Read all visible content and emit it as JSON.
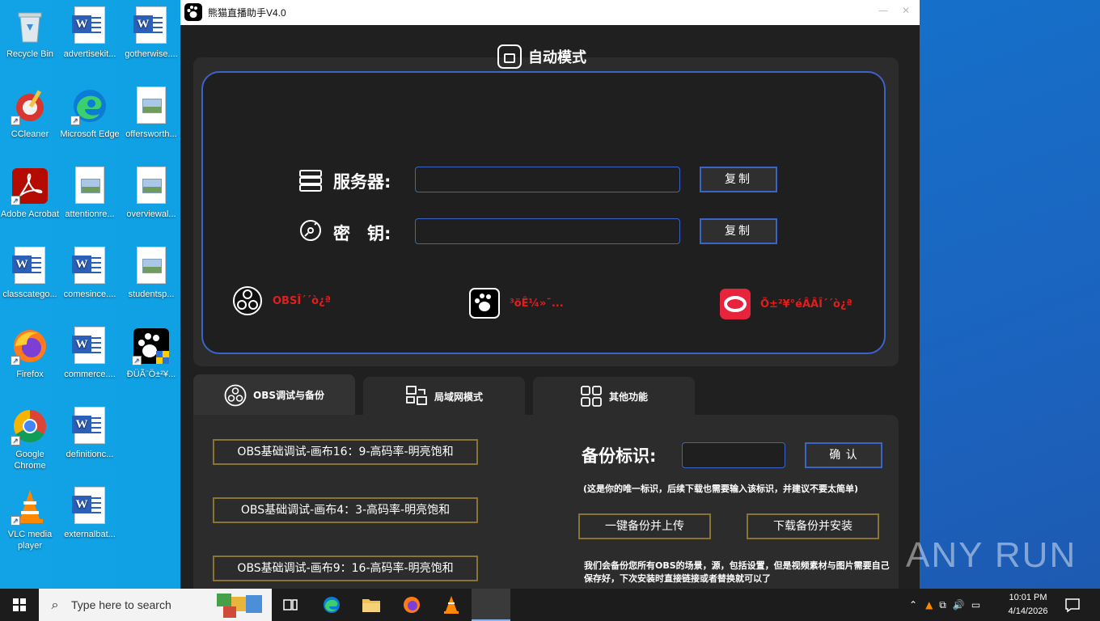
{
  "desktop": {
    "icons": [
      {
        "label": "Recycle Bin"
      },
      {
        "label": "advertisekit..."
      },
      {
        "label": "gotherwise...."
      },
      {
        "label": "CCleaner"
      },
      {
        "label": "Microsoft Edge"
      },
      {
        "label": "offersworth..."
      },
      {
        "label": "Adobe Acrobat"
      },
      {
        "label": "attentionre..."
      },
      {
        "label": "overviewal..."
      },
      {
        "label": "classcatego..."
      },
      {
        "label": "comesince...."
      },
      {
        "label": "studentsp..."
      },
      {
        "label": "Firefox"
      },
      {
        "label": "commerce...."
      },
      {
        "label": "ÐÜÃ¨Ö±²¥..."
      },
      {
        "label": "Google Chrome"
      },
      {
        "label": "definitionc..."
      },
      {
        "label": "VLC media player"
      },
      {
        "label": "externalbat..."
      }
    ]
  },
  "app": {
    "title": "熊猫直播助手V4.0",
    "header": "自动模式",
    "server_label": "服务器:",
    "key_label": "密　钥:",
    "server_value": "",
    "key_value": "",
    "copy_label": "复制",
    "tiles": [
      {
        "text": "OBSÎ´´ò¿ª"
      },
      {
        "text": "³öÊ¼»¯..."
      },
      {
        "text": "Ö±²¥°éÂÂÎ´´ò¿ª"
      }
    ],
    "tabs": [
      {
        "label": "OBS调试与备份"
      },
      {
        "label": "局域网模式"
      },
      {
        "label": "其他功能"
      }
    ],
    "obs_buttons": [
      {
        "label": "OBS基础调试-画布16：9-高码率-明亮饱和"
      },
      {
        "label": "OBS基础调试-画布4：3-高码率-明亮饱和"
      },
      {
        "label": "OBS基础调试-画布9：16-高码率-明亮饱和"
      }
    ],
    "backup": {
      "label": "备份标识:",
      "value": "",
      "confirm": "确 认",
      "hint": "(这是你的唯一标识，后续下载也需要输入该标识，并建议不要太简单)",
      "upload": "一键备份并上传",
      "download": "下载备份并安装",
      "note": "我们会备份您所有OBS的场景，源，包括设置，但是视频素材与图片需要自己保存好，下次安装时直接链接或者替换就可以了"
    }
  },
  "watermark": "ANY RUN",
  "taskbar": {
    "search_placeholder": "Type here to search",
    "time": "10:01 PM",
    "date": "4/14/2026"
  },
  "colors": {
    "accent_blue": "#3b64c8",
    "gold_border": "#8a7434",
    "tile_red": "#e01e1e"
  }
}
